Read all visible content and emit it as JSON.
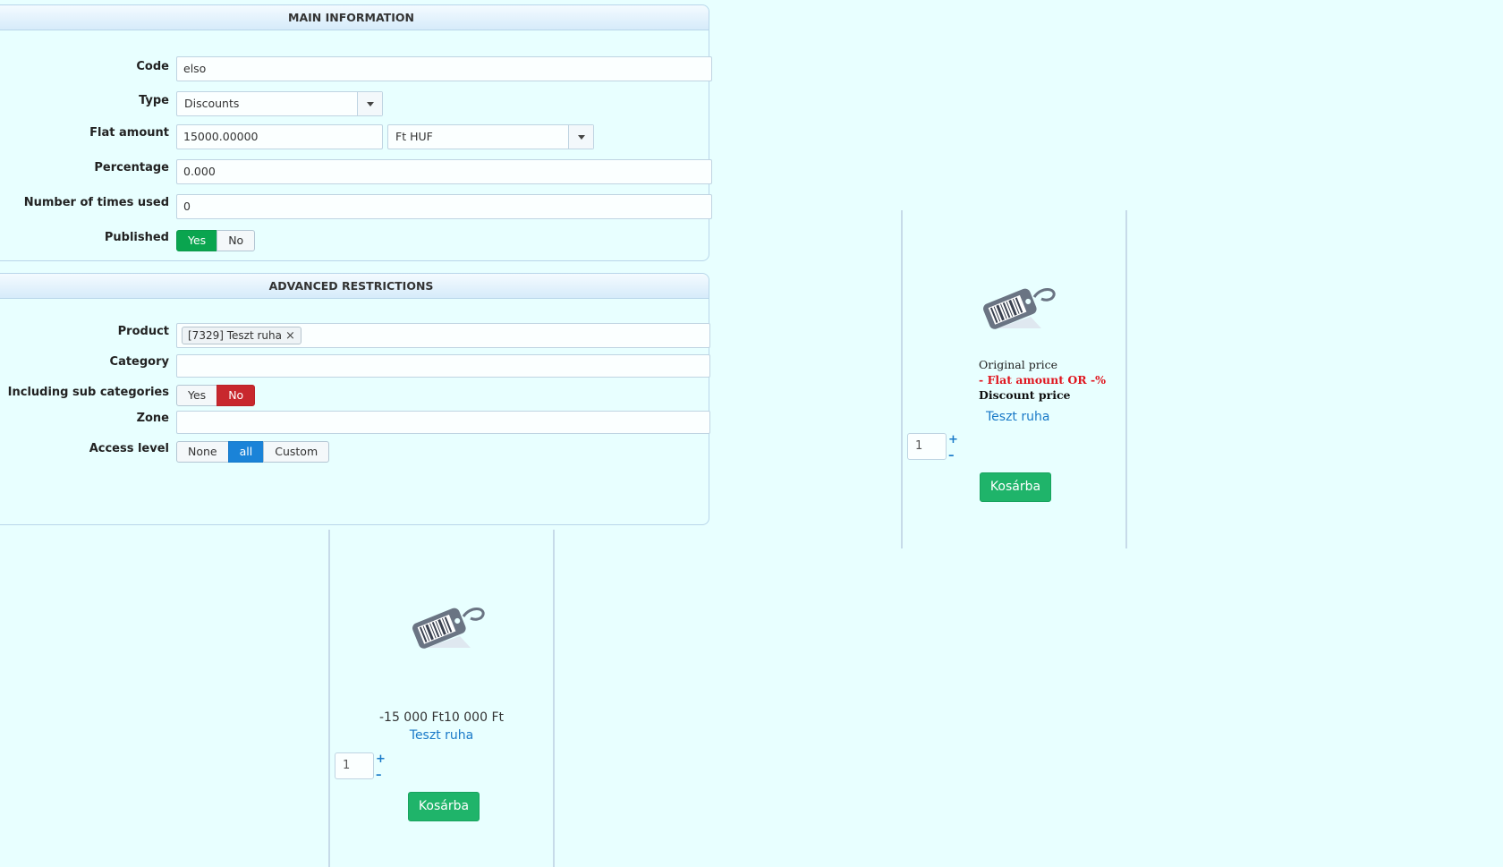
{
  "main": {
    "title": "MAIN INFORMATION",
    "code": {
      "label": "Code",
      "value": "elso"
    },
    "type": {
      "label": "Type",
      "value": "Discounts"
    },
    "flat_amount": {
      "label": "Flat amount",
      "value": "15000.00000",
      "currency": "Ft HUF"
    },
    "percentage": {
      "label": "Percentage",
      "value": "0.000"
    },
    "times_used": {
      "label": "Number of times used",
      "value": "0"
    },
    "published": {
      "label": "Published",
      "yes": "Yes",
      "no": "No",
      "selected": "Yes"
    }
  },
  "advanced": {
    "title": "ADVANCED RESTRICTIONS",
    "product": {
      "label": "Product",
      "tag": "[7329] Teszt ruha",
      "remove": "×"
    },
    "category": {
      "label": "Category",
      "value": ""
    },
    "sub_categories": {
      "label": "Including sub categories",
      "yes": "Yes",
      "no": "No",
      "selected": "No"
    },
    "zone": {
      "label": "Zone",
      "value": ""
    },
    "access_level": {
      "label": "Access level",
      "options": [
        "None",
        "all",
        "Custom"
      ],
      "selected": "all"
    }
  },
  "card1": {
    "original_price": "Original price",
    "flat_amount": "- Flat amount OR -%",
    "discount_price": "Discount price",
    "product_name": "Teszt ruha",
    "quantity": "1",
    "plus": "+",
    "minus": "–",
    "cart_label": "Kosárba"
  },
  "card2": {
    "price_text": "-15 000 Ft10 000 Ft",
    "product_name": "Teszt ruha",
    "quantity": "1",
    "plus": "+",
    "minus": "–",
    "cart_label": "Kosárba"
  },
  "colors": {
    "background": "#e8ffff",
    "published_yes": "#0aa54f",
    "subcat_no": "#c8282e",
    "access_all": "#1a83d8",
    "cart": "#1fb46a",
    "link": "#1a7ac8",
    "flat_red": "#e0161f"
  }
}
